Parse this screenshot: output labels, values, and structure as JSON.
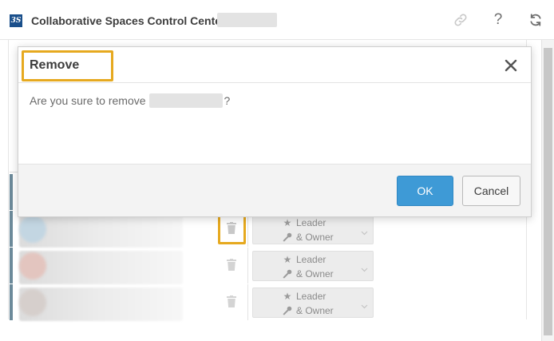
{
  "header": {
    "logo_text": "3S",
    "title": "Collaborative Spaces Control Center -",
    "icons": [
      "link-icon",
      "help-icon",
      "refresh-icon"
    ],
    "help_glyph": "?"
  },
  "dialog": {
    "title": "Remove",
    "message_prefix": "Are you sure to remove",
    "message_suffix": "?",
    "ok_label": "OK",
    "cancel_label": "Cancel",
    "close_glyph": "close-icon"
  },
  "members": [
    {
      "role_line1": "Leader",
      "role_line2": "& Owner"
    },
    {
      "role_line1": "Leader",
      "role_line2": "& Owner"
    },
    {
      "role_line1": "Leader",
      "role_line2": "& Owner"
    }
  ],
  "colors": {
    "accent_highlight": "#e6a91f",
    "primary_button": "#3e9ad6",
    "logo_bg": "#1a4f8b"
  }
}
